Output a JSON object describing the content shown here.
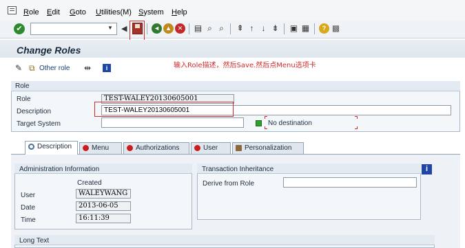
{
  "menu": [
    "Role",
    "Edit",
    "Goto",
    "Utilities(M)",
    "System",
    "Help"
  ],
  "menu_underline": [
    "R",
    "E",
    "G",
    "U",
    "S",
    "H"
  ],
  "menu_rest": [
    "ole",
    "dit",
    "oto",
    "tilities(M)",
    "ystem",
    "elp"
  ],
  "toolbar": {
    "command_value": "",
    "check_glyph": "✔",
    "back_glyph": "◀"
  },
  "page_title": "Change Roles",
  "instruction": "输入Role描述，然后Save.然后点Menu选项卡",
  "app_toolbar": {
    "other_role_label": "Other role"
  },
  "role_group": {
    "title": "Role",
    "role_label": "Role",
    "role_value": "TEST-WALEY20130605001",
    "description_label": "Description",
    "description_value": "TEST-WALEY20130605001",
    "target_label": "Target System",
    "target_value": "",
    "no_destination": "No destination"
  },
  "tabs": [
    "Description",
    "Menu",
    "Authorizations",
    "User",
    "Personalization"
  ],
  "admin": {
    "title": "Administration Information",
    "created_label": "Created",
    "user_label": "User",
    "user_value": "WALEYWANG",
    "date_label": "Date",
    "date_value": "2013-06-05",
    "time_label": "Time",
    "time_value": "16:11:39"
  },
  "inheritance": {
    "title": "Transaction Inheritance",
    "derive_label": "Derive from Role",
    "derive_value": ""
  },
  "long_text": {
    "title": "Long Text"
  },
  "colors": {
    "highlight": "#d42a2a",
    "title_text": "#1a2a3a",
    "info_blue": "#1f46a6",
    "status_green": "#2ea02e"
  }
}
